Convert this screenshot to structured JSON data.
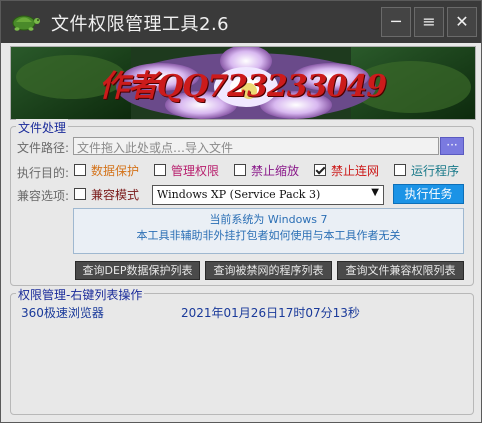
{
  "window": {
    "title": "文件权限管理工具2.6",
    "buttons": {
      "minimize": "─",
      "menu": "≡",
      "close": "✕"
    }
  },
  "banner": {
    "text": "作者QQ723233049"
  },
  "file_group": {
    "title": "文件处理",
    "path_label": "文件路径:",
    "path_placeholder": "文件拖入此处或点…导入文件",
    "browse_label": "···",
    "purpose_label": "执行目的:",
    "options": [
      {
        "label": "数据保护",
        "checked": false,
        "color": "#d4731a"
      },
      {
        "label": "管理权限",
        "checked": false,
        "color": "#b8206e"
      },
      {
        "label": "禁止缩放",
        "checked": false,
        "color": "#8a1a8a"
      },
      {
        "label": "禁止连网",
        "checked": true,
        "color": "#cc1b1b"
      },
      {
        "label": "运行程序",
        "checked": false,
        "color": "#1a7a8a"
      }
    ],
    "compat_label": "兼容选项:",
    "compat_mode": {
      "label": "兼容模式",
      "checked": false,
      "color": "#7a1a1a"
    },
    "compat_select": "Windows XP (Service Pack 3)",
    "execute_label": "执行任务",
    "info_line1": "当前系统为 Windows 7",
    "info_line2": "本工具非辅助非外挂打包者如何使用与本工具作者无关",
    "actions": [
      "查询DEP数据保护列表",
      "查询被禁网的程序列表",
      "查询文件兼容权限列表"
    ]
  },
  "perm_group": {
    "title": "权限管理-右键列表操作",
    "rows": [
      {
        "name": "360极速浏览器",
        "time": "2021年01月26日17时07分13秒"
      }
    ]
  },
  "colors": {
    "titlebar": "#3a3a3a",
    "accent_blue": "#1b93e6",
    "group_title": "#1a2b9a",
    "list_text": "#1a3a9a"
  }
}
